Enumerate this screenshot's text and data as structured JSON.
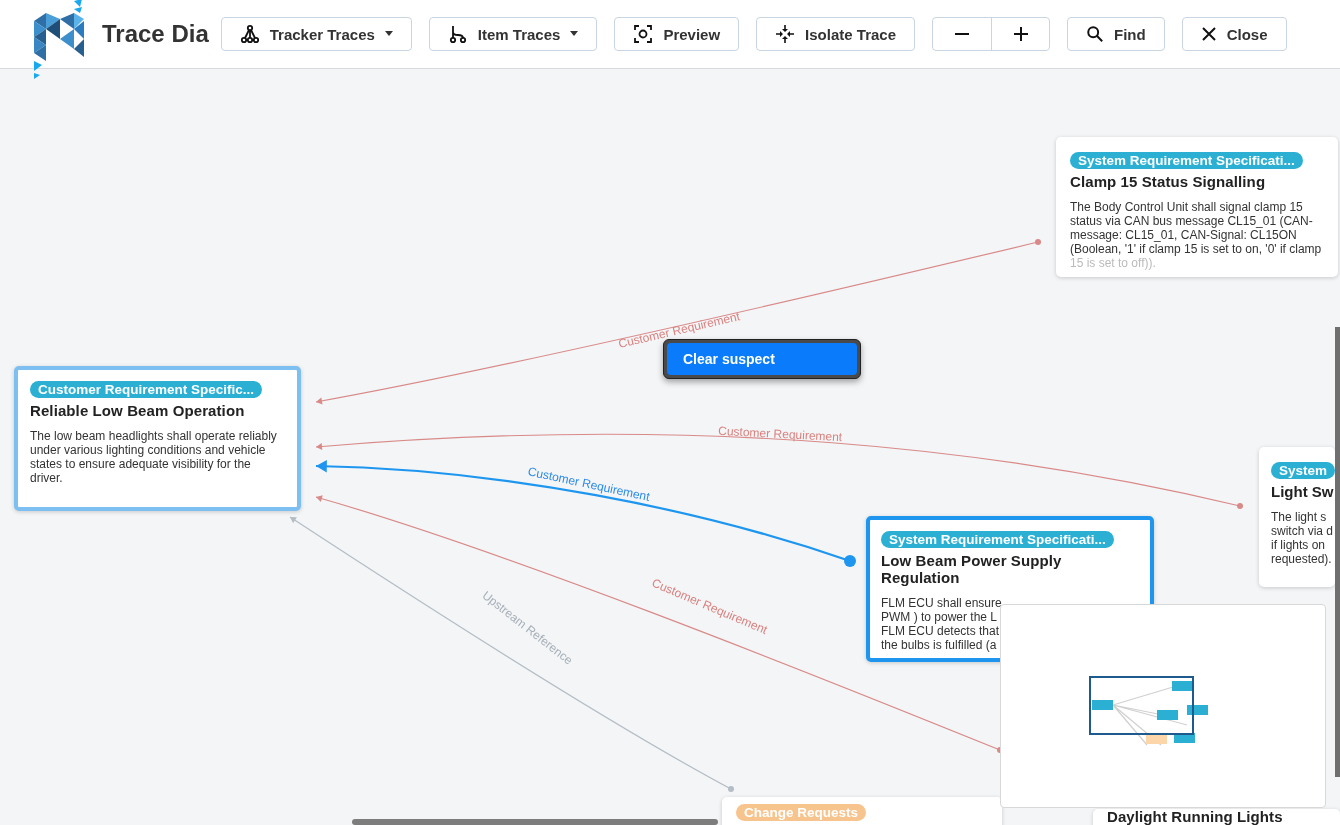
{
  "header": {
    "title": "Trace Dia",
    "buttons": [
      {
        "label": "Tracker Traces",
        "kind": "dropdown"
      },
      {
        "label": "Item Traces",
        "kind": "dropdown"
      },
      {
        "label": "Preview",
        "kind": "plain"
      },
      {
        "label": "Isolate Trace",
        "kind": "plain"
      },
      {
        "kind": "zoom"
      },
      {
        "label": "Find",
        "kind": "plain"
      },
      {
        "label": "Close",
        "kind": "plain"
      }
    ]
  },
  "nodes": [
    {
      "tag": "System Requirement Specificati...",
      "color": "#2bb0d4",
      "title": "Clamp 15 Status Signalling",
      "description": [
        "The Body Control Unit shall signal clamp 15",
        "status via CAN bus message CL15_01 (CAN-",
        "message: CL15_01, CAN-Signal: CL15ON",
        "(Boolean, '1' if clamp 15 is set to on, '0' if clamp",
        "15 is set to off))."
      ],
      "selected": false,
      "focused": false
    },
    {
      "tag": "Customer Requirement Specific...",
      "color": "#2bb0d4",
      "title": "Reliable Low Beam Operation",
      "description": [
        "The low beam headlights shall operate reliably",
        "under various lighting conditions and vehicle",
        "states to ensure adequate visibility for the",
        "driver."
      ],
      "selected": false,
      "focused": true
    },
    {
      "tag": "System",
      "color": "#2bb0d4",
      "title": "Light Sw",
      "description": [
        "The light s",
        "switch via d",
        "if lights on",
        "requested)."
      ],
      "selected": false,
      "focused": false
    },
    {
      "tag": "System Requirement Specificati...",
      "color": "#2bb0d4",
      "title": "Low Beam Power Supply Regulation",
      "description": [
        "FLM ECU shall ensure",
        "PWM ) to power the L",
        "FLM ECU detects that",
        "the bulbs is fulfilled (a"
      ],
      "selected": true,
      "focused": false
    },
    {
      "tag": "Change Requests",
      "color": "#f7c48e",
      "selected": false,
      "focused": false
    },
    {
      "title": "Daylight Running Lights",
      "selected": false,
      "focused": false
    }
  ],
  "edges": [
    {
      "label": "Customer Requirement",
      "kind": "customer",
      "selected": false
    },
    {
      "label": "Customer Requirement",
      "kind": "customer",
      "selected": false
    },
    {
      "label": "Customer Requirement",
      "kind": "customer",
      "selected": true
    },
    {
      "label": "Customer Requirement",
      "kind": "customer",
      "selected": false
    },
    {
      "label": "Upstream Reference",
      "kind": "upstream",
      "selected": false
    }
  ],
  "context_menu": {
    "items": [
      {
        "label": "Clear suspect",
        "selected": true
      }
    ]
  }
}
